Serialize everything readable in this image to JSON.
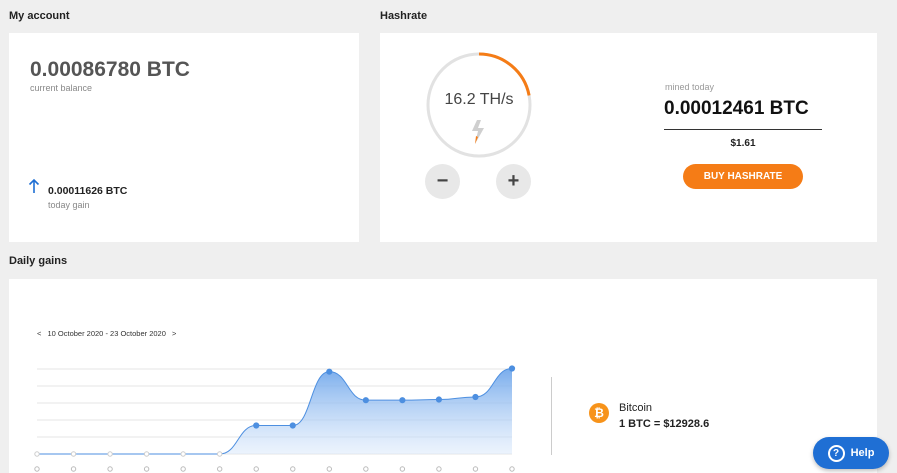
{
  "account": {
    "title": "My account",
    "balance": "0.00086780 BTC",
    "balance_label": "current balance",
    "today_gain": "0.00011626 BTC",
    "today_gain_label": "today gain"
  },
  "hashrate": {
    "title": "Hashrate",
    "value": "16.2 TH/s",
    "gauge_fraction": 0.22,
    "minus_label": "−",
    "plus_label": "+",
    "mined_label": "mined today",
    "mined_value": "0.00012461 BTC",
    "mined_usd": "$1.61",
    "buy_label": "BUY HASHRATE"
  },
  "daily": {
    "title": "Daily gains",
    "prev": "<",
    "range": "10 October 2020 - 23 October 2020",
    "next": ">"
  },
  "coin": {
    "name": "Bitcoin",
    "price": "1 BTC = $12928.6"
  },
  "help": {
    "label": "Help"
  },
  "colors": {
    "accent": "#f57c16",
    "chart_line": "#4d8fe0",
    "help": "#1f6fd4"
  },
  "chart_data": {
    "type": "area",
    "title": "",
    "xlabel": "",
    "ylabel": "",
    "grid": true,
    "legend": "none",
    "values": [
      0,
      0,
      0,
      0,
      0,
      0,
      0.45,
      0.45,
      1.3,
      0.85,
      0.85,
      0.86,
      0.9,
      1.35
    ],
    "ylim": [
      0,
      1.5
    ]
  }
}
